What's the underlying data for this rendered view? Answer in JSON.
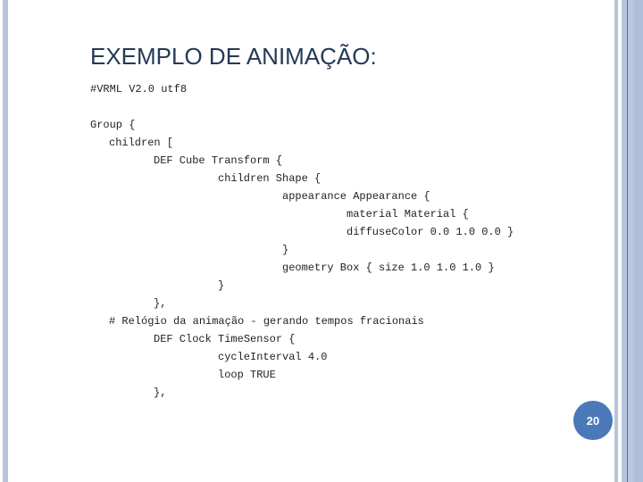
{
  "slide": {
    "title": "EXEMPLO DE ANIMAÇÃO:",
    "page_number": "20",
    "accent_color": "#4a78b8",
    "code_lines": [
      {
        "indent": 0,
        "text": "#VRML V2.0 utf8"
      },
      {
        "indent": 0,
        "text": ""
      },
      {
        "indent": 0,
        "text": "Group {"
      },
      {
        "indent": 1,
        "text": "children ["
      },
      {
        "indent": 2,
        "text": "DEF Cube Transform {"
      },
      {
        "indent": 3,
        "text": "children Shape {"
      },
      {
        "indent": 4,
        "text": "appearance Appearance {"
      },
      {
        "indent": 5,
        "text": "material Material {"
      },
      {
        "indent": 5,
        "text": "diffuseColor 0.0 1.0 0.0 }"
      },
      {
        "indent": 4,
        "text": "}"
      },
      {
        "indent": 4,
        "text": "geometry Box { size 1.0 1.0 1.0 }"
      },
      {
        "indent": 3,
        "text": "}"
      },
      {
        "indent": 2,
        "text": "},"
      },
      {
        "indent": 1,
        "text": "# Relógio da animação - gerando tempos fracionais"
      },
      {
        "indent": 2,
        "text": "DEF Clock TimeSensor {"
      },
      {
        "indent": 3,
        "text": "cycleInterval 4.0"
      },
      {
        "indent": 3,
        "text": "loop TRUE"
      },
      {
        "indent": 2,
        "text": "},"
      }
    ]
  }
}
